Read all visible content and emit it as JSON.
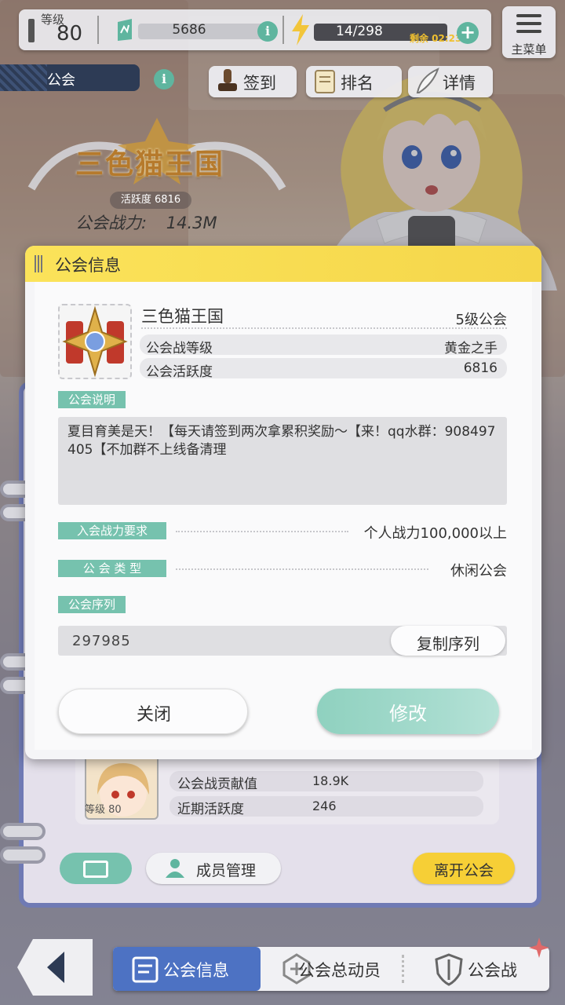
{
  "topbar": {
    "level_label": "等级",
    "level_value": "80",
    "stamina": "5686",
    "info_glyph": "i",
    "energy": "14/298",
    "energy_timer": "剩余 02:23",
    "plus_glyph": "+",
    "menu_label": "主菜单"
  },
  "guild_header": {
    "tab_label": "公会",
    "actions": [
      {
        "label": "签到",
        "icon": "stamp-icon"
      },
      {
        "label": "排名",
        "icon": "scroll-icon"
      },
      {
        "label": "详情",
        "icon": "quill-icon"
      }
    ],
    "guild_name": "三色猫王国",
    "activity": "活跃度 6816",
    "power_label": "公会战力:",
    "power_value": "14.3M"
  },
  "modal": {
    "title": "公会信息",
    "guild_name": "三色猫王国",
    "guild_level": "5级公会",
    "rows": [
      {
        "key": "公会战等级",
        "value": "黄金之手"
      },
      {
        "key": "公会活跃度",
        "value": "6816"
      }
    ],
    "description_tag": "公会说明",
    "description": "夏目育美是天！【每天请签到两次拿累积奖励～【来！qq水群：908497405【不加群不上线备清理",
    "requirement_tag": "入会战力要求",
    "requirement_value": "个人战力100,000以上",
    "type_tag": "公 会 类 型",
    "type_value": "休闲公会",
    "serial_tag": "公会序列",
    "serial_value": "297985",
    "copy_label": "复制序列",
    "close_label": "关闭",
    "edit_label": "修改"
  },
  "member_card": {
    "level": "等级 80",
    "rows": [
      {
        "key": "公会战贡献值",
        "value": "18.9K"
      },
      {
        "key": "近期活跃度",
        "value": "246"
      }
    ]
  },
  "panel_buttons": {
    "manage_label": "成员管理",
    "leave_label": "离开公会"
  },
  "bottom_nav": {
    "items": [
      {
        "label": "公会信息",
        "active": true
      },
      {
        "label": "公会总动员",
        "active": false
      },
      {
        "label": "公会战",
        "active": false
      }
    ]
  },
  "colors": {
    "accent_teal": "#76c2ae",
    "header_yellow": "#f5d64a",
    "nav_active_blue": "#4d72c3",
    "leave_yellow": "#f6cf36"
  }
}
